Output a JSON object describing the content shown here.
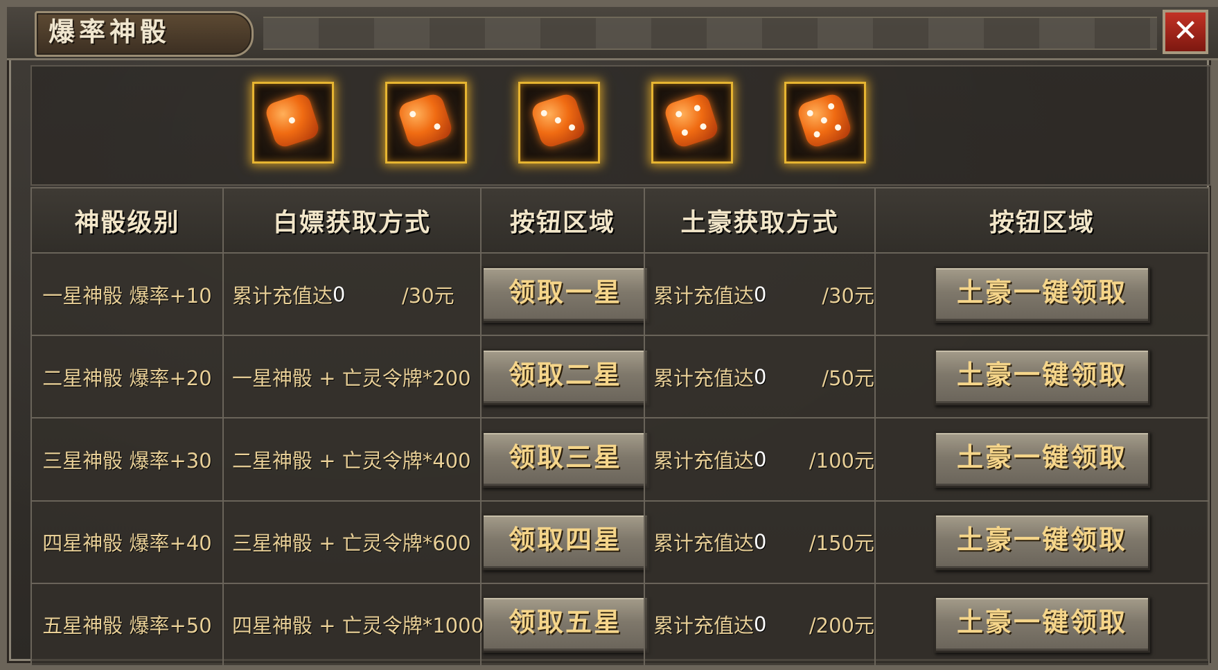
{
  "window": {
    "title": "爆率神骰",
    "close_label": "✕"
  },
  "dice": [
    {
      "icon": "die-1-star"
    },
    {
      "icon": "die-2-star"
    },
    {
      "icon": "die-3-star"
    },
    {
      "icon": "die-4-star"
    },
    {
      "icon": "die-5-star"
    }
  ],
  "table": {
    "headers": [
      "神骰级别",
      "白嫖获取方式",
      "按钮区域",
      "土豪获取方式",
      "按钮区域"
    ],
    "rows": [
      {
        "level": "一星神骰  爆率+10",
        "free": "累计充值达",
        "free_current": "0",
        "free_target": "/30元",
        "claim_label": "领取一星",
        "paid_label": "累计充值达",
        "paid_current": "0",
        "paid_target": "/30元",
        "tuhao_label": "土豪一键领取"
      },
      {
        "level": "二星神骰  爆率+20",
        "free": "一星神骰 + 亡灵令牌*200",
        "claim_label": "领取二星",
        "paid_label": "累计充值达",
        "paid_current": "0",
        "paid_target": "/50元",
        "tuhao_label": "土豪一键领取"
      },
      {
        "level": "三星神骰  爆率+30",
        "free": "二星神骰 + 亡灵令牌*400",
        "claim_label": "领取三星",
        "paid_label": "累计充值达",
        "paid_current": "0",
        "paid_target": "/100元",
        "tuhao_label": "土豪一键领取"
      },
      {
        "level": "四星神骰  爆率+40",
        "free": "三星神骰 + 亡灵令牌*600",
        "claim_label": "领取四星",
        "paid_label": "累计充值达",
        "paid_current": "0",
        "paid_target": "/150元",
        "tuhao_label": "土豪一键领取"
      },
      {
        "level": "五星神骰  爆率+50",
        "free": "四星神骰 + 亡灵令牌*1000",
        "claim_label": "领取五星",
        "paid_label": "累计充值达",
        "paid_current": "0",
        "paid_target": "/200元",
        "tuhao_label": "土豪一键领取"
      }
    ]
  },
  "colors": {
    "gold_text": "#e8cf97",
    "button_text": "#f5d58a",
    "die_frame": "#e7b531",
    "close_bg": "#c23225"
  }
}
